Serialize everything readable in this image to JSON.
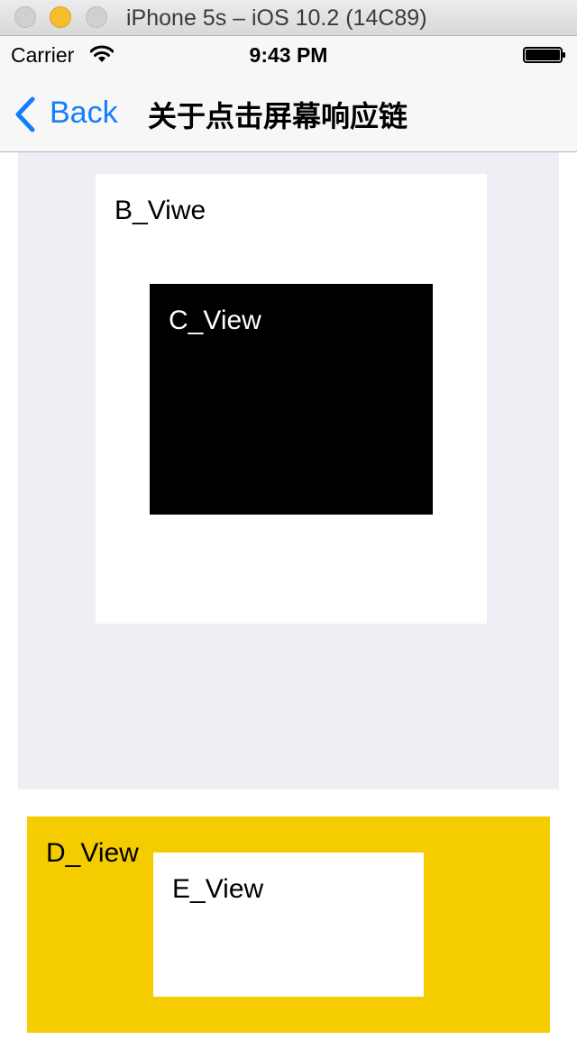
{
  "window": {
    "title": "iPhone 5s – iOS 10.2 (14C89)"
  },
  "status_bar": {
    "carrier": "Carrier",
    "time": "9:43 PM",
    "wifi_icon": "wifi-icon",
    "battery_icon": "battery-icon",
    "battery_level": 1.0
  },
  "nav_bar": {
    "back_label": "Back",
    "back_icon": "chevron-left-icon",
    "title": "关于点击屏幕响应链",
    "tint_color": "#147efb"
  },
  "views": {
    "b_label": "B_Viwe",
    "c_label": "C_View",
    "d_label": "D_View",
    "e_label": "E_View"
  },
  "colors": {
    "a_view_bg": "#eeeef4",
    "b_view_bg": "#ffffff",
    "c_view_bg": "#000000",
    "d_view_bg": "#f5cc00",
    "e_view_bg": "#ffffff"
  }
}
